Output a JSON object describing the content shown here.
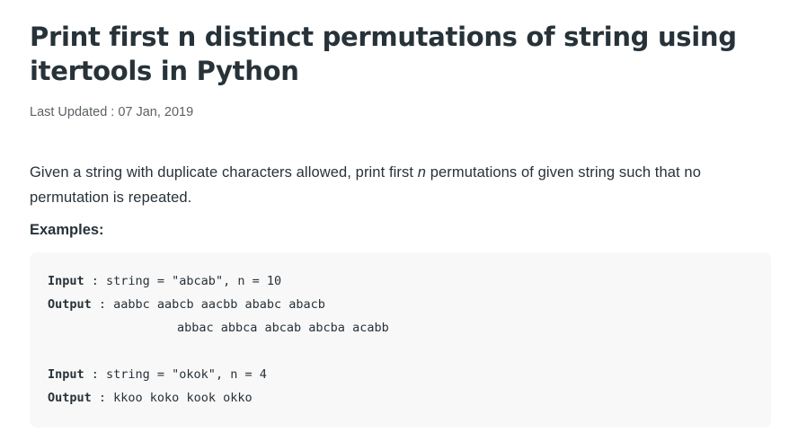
{
  "article": {
    "title": "Print first n distinct permutations of string using itertools in Python",
    "meta_label": "Last Updated :",
    "meta_date": "07 Jan, 2019",
    "intro_before": "Given a string with duplicate characters allowed, print first ",
    "intro_emph": "n",
    "intro_after": " permutations of given string such that no permutation is repeated.",
    "examples_heading": "Examples:"
  },
  "examples": [
    {
      "input_label": "Input",
      "input_text": " : string = \"abcab\", n = 10",
      "output_label": "Output",
      "output_text": " : aabbc aabcb aacbb ababc abacb",
      "output_cont": "abbac abbca abcab abcba acabb"
    },
    {
      "input_label": "Input",
      "input_text": " : string = \"okok\", n = 4",
      "output_label": "Output",
      "output_text": " : kkoo koko kook okko"
    }
  ]
}
